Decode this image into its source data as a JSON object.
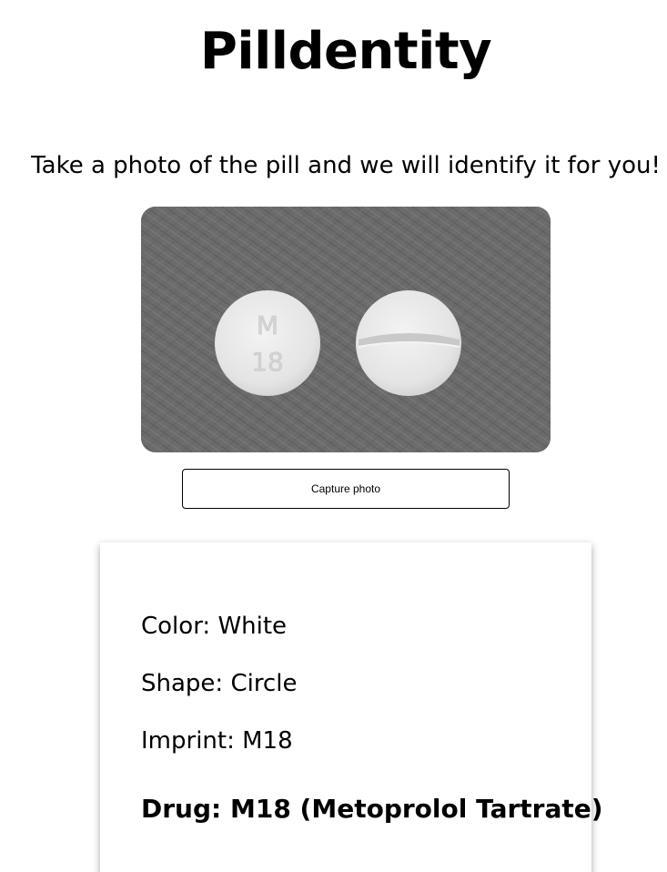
{
  "header": {
    "title": "Pilldentity",
    "subtitle": "Take a photo of the pill and we will identify it for you!"
  },
  "camera": {
    "pill_imprint_lines": [
      "M",
      "18"
    ],
    "capture_label": "Capture photo"
  },
  "result": {
    "color": "Color: White",
    "shape": "Shape: Circle",
    "imprint": "Imprint: M18",
    "drug": "Drug: M18 (Metoprolol Tartrate)"
  },
  "colors": {
    "background": "#ffffff",
    "photo_background": "#6e6e6e",
    "pill_color": "#e9e9e9",
    "text": "#000000"
  }
}
